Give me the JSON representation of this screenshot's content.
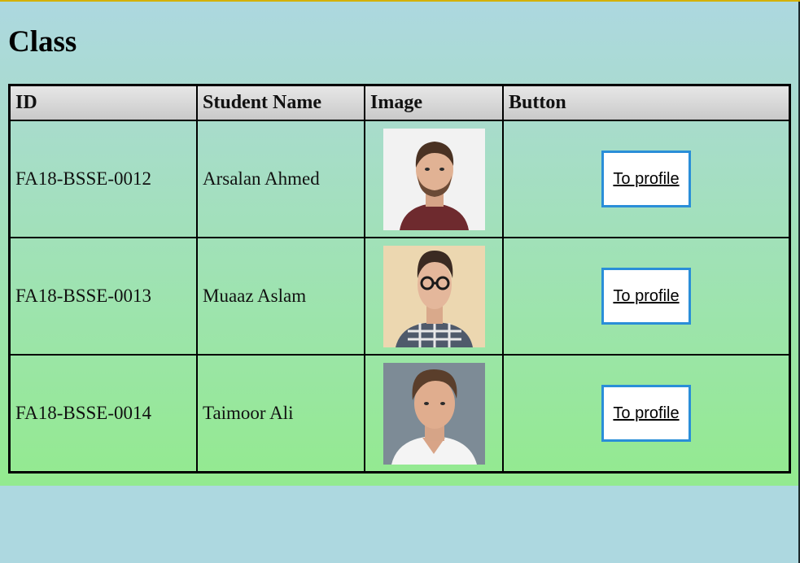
{
  "page": {
    "title": "Class"
  },
  "table": {
    "headers": [
      "ID",
      "Student Name",
      "Image",
      "Button"
    ],
    "rows": [
      {
        "id": "FA18-BSSE-0012",
        "name": "Arsalan Ahmed",
        "image": "student-photo-icon",
        "button": "To profile"
      },
      {
        "id": "FA18-BSSE-0013",
        "name": "Muaaz Aslam",
        "image": "student-photo-icon",
        "button": "To profile"
      },
      {
        "id": "FA18-BSSE-0014",
        "name": "Taimoor Ali",
        "image": "student-photo-icon",
        "button": "To profile"
      }
    ]
  },
  "colors": {
    "button_border": "#2a8ed8",
    "background": "#add8e0",
    "gradient_bottom": "#93ea8f"
  }
}
